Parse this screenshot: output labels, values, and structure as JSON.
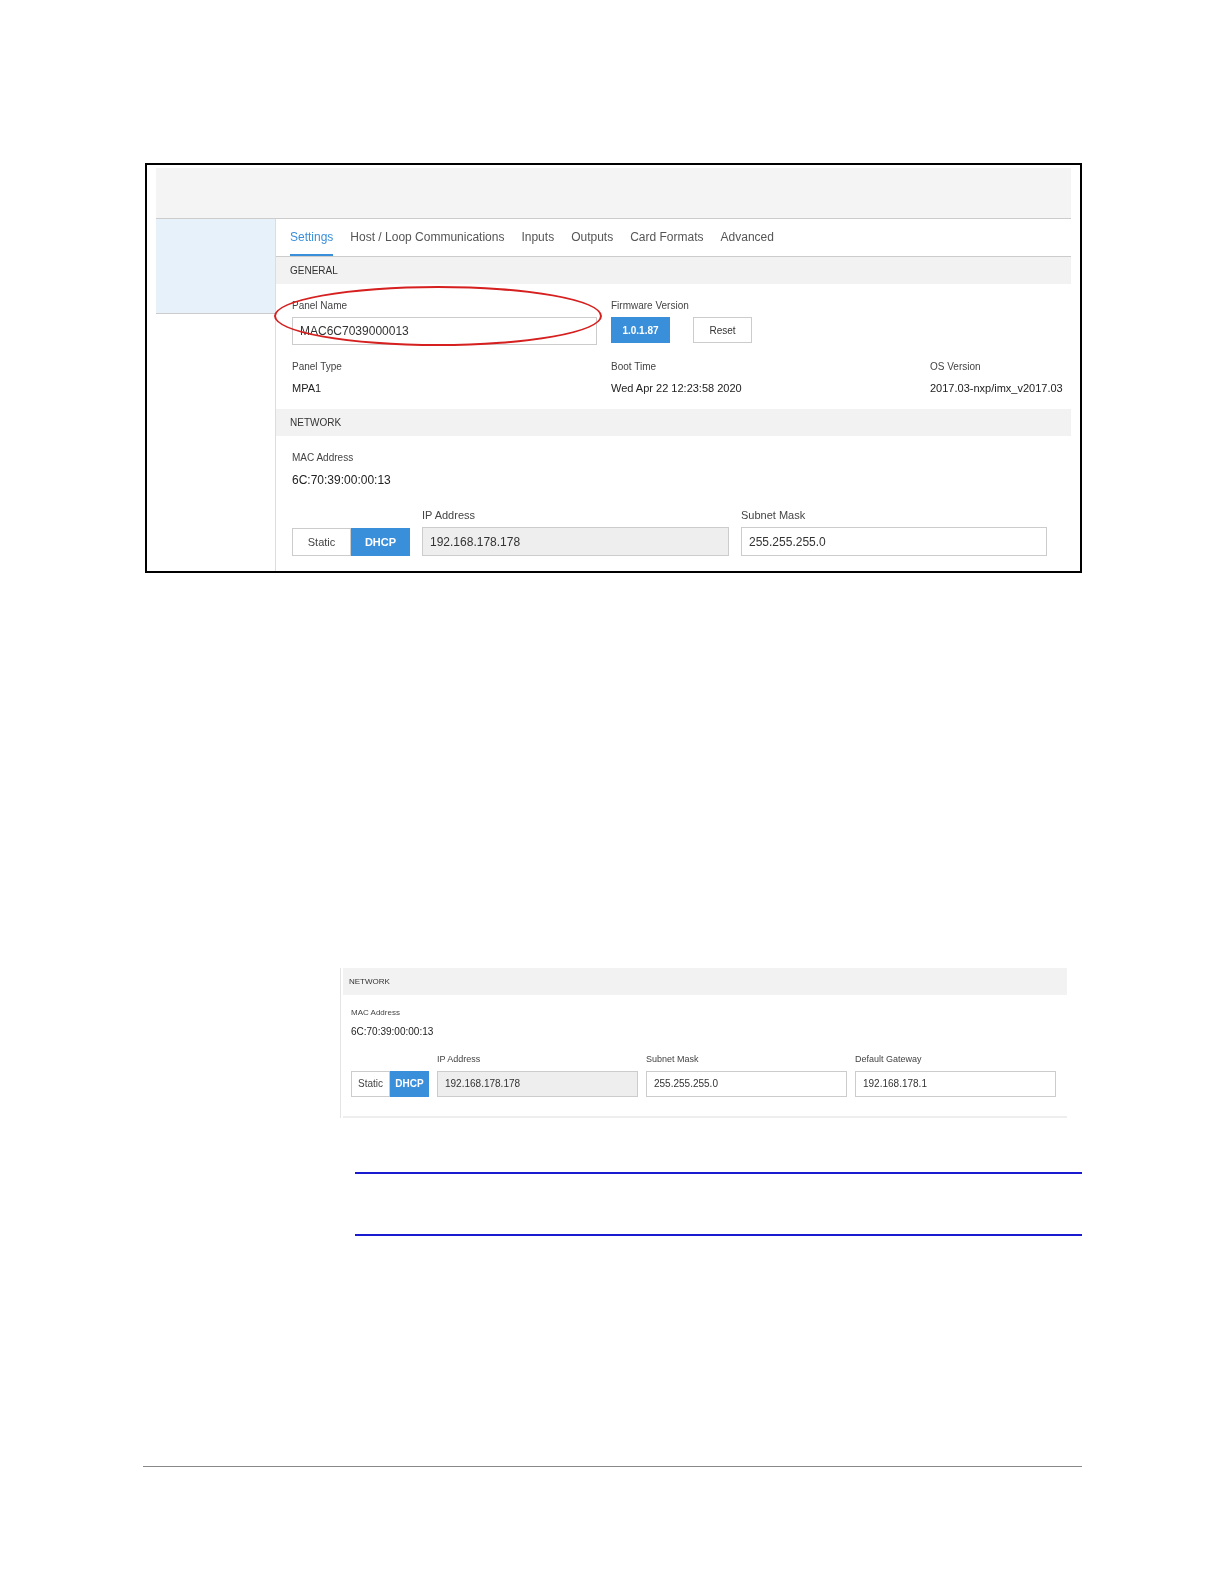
{
  "screenshot_1": {
    "tabs": [
      {
        "label": "Settings",
        "selected": true
      },
      {
        "label": "Host / Loop Communications",
        "selected": false
      },
      {
        "label": "Inputs",
        "selected": false
      },
      {
        "label": "Outputs",
        "selected": false
      },
      {
        "label": "Card Formats",
        "selected": false
      },
      {
        "label": "Advanced",
        "selected": false
      }
    ],
    "general": {
      "heading": "GENERAL",
      "panel_name": {
        "label": "Panel Name",
        "value": "MAC6C7039000013",
        "circled": true
      },
      "firmware": {
        "label": "Firmware Version",
        "version_button": "1.0.1.87",
        "reset_button": "Reset"
      },
      "info": [
        {
          "label": "Panel Type",
          "value": "MPA1"
        },
        {
          "label": "Boot Time",
          "value": "Wed Apr 22 12:23:58 2020"
        },
        {
          "label": "OS Version",
          "value": "2017.03-nxp/imx_v2017.03"
        }
      ]
    },
    "network": {
      "heading": "NETWORK",
      "mac": {
        "label": "MAC Address",
        "value": "6C:70:39:00:00:13"
      },
      "modes": [
        {
          "label": "Static",
          "selected": false
        },
        {
          "label": "DHCP",
          "selected": true
        }
      ],
      "fields": [
        {
          "label": "IP Address",
          "value": "192.168.178.178",
          "disabled": true
        },
        {
          "label": "Subnet Mask",
          "value": "255.255.255.0",
          "disabled": false
        }
      ]
    }
  },
  "screenshot_2": {
    "network": {
      "heading": "NETWORK",
      "mac": {
        "label": "MAC Address",
        "value": "6C:70:39:00:00:13"
      },
      "modes": [
        {
          "label": "Static",
          "selected": false
        },
        {
          "label": "DHCP",
          "selected": true
        }
      ],
      "fields": [
        {
          "label": "IP Address",
          "value": "192.168.178.178",
          "disabled": true
        },
        {
          "label": "Subnet Mask",
          "value": "255.255.255.0",
          "disabled": false
        },
        {
          "label": "Default Gateway",
          "value": "192.168.178.1",
          "disabled": false
        }
      ]
    }
  }
}
